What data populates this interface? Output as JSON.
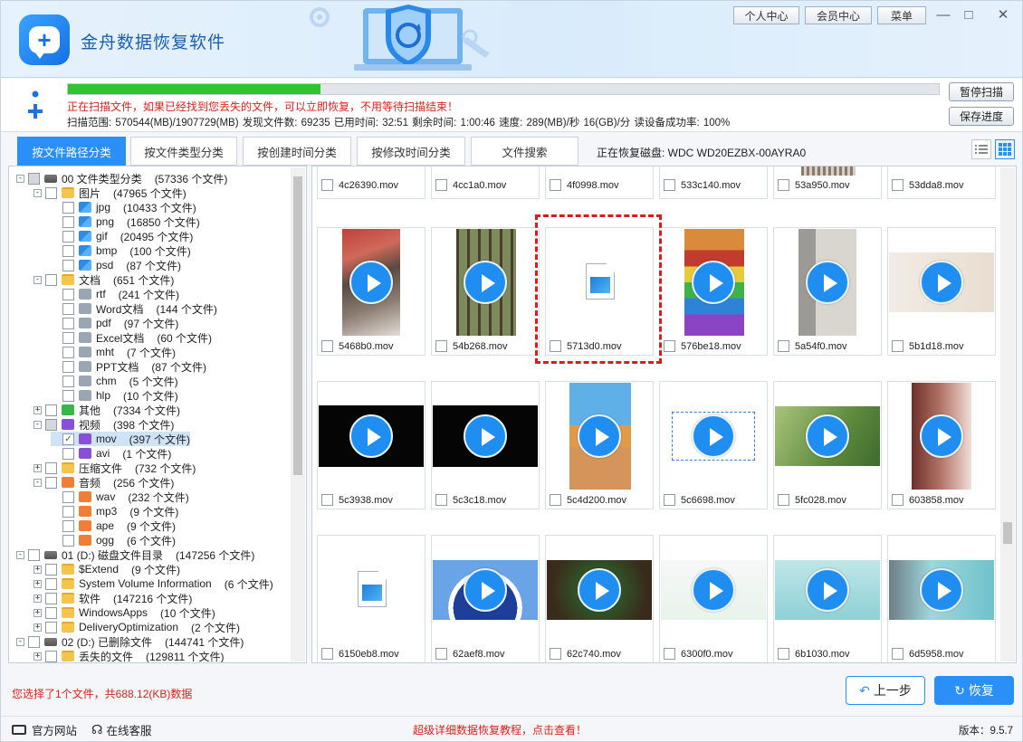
{
  "app": {
    "title": "金舟数据恢复软件",
    "version": "版本：9.5.7"
  },
  "header": {
    "personal": "个人中心",
    "member": "会员中心",
    "menu": "菜单"
  },
  "scan": {
    "progress": 0.29,
    "message": "正在扫描文件，如果已经找到您丢失的文件，可以立即恢复，不用等待扫描结束！",
    "stats": "扫描范围: 570544(MB)/1907729(MB)   发现文件数: 69235   已用时间: 32:51   剩余时间: 1:00:46   速度: 289(MB)/秒  16(GB)/分   读设备成功率: 100%",
    "pause": "暂停扫描",
    "save": "保存进度"
  },
  "tabs": [
    "按文件路径分类",
    "按文件类型分类",
    "按创建时间分类",
    "按修改时间分类",
    "文件搜索"
  ],
  "disk": "正在恢复磁盘: WDC WD20EZBX-00AYRA0",
  "tree": [
    {
      "d": 0,
      "exp": "-",
      "cb": "part",
      "ic": "drive",
      "label": "00 文件类型分类",
      "count": "(57336 个文件)"
    },
    {
      "d": 1,
      "exp": "-",
      "cb": "",
      "ic": "folder",
      "label": "图片",
      "count": "(47965 个文件)"
    },
    {
      "d": 2,
      "exp": "",
      "cb": "",
      "ic": "img",
      "label": "jpg",
      "count": "(10433 个文件)"
    },
    {
      "d": 2,
      "exp": "",
      "cb": "",
      "ic": "img",
      "label": "png",
      "count": "(16850 个文件)"
    },
    {
      "d": 2,
      "exp": "",
      "cb": "",
      "ic": "img",
      "label": "gif",
      "count": "(20495 个文件)"
    },
    {
      "d": 2,
      "exp": "",
      "cb": "",
      "ic": "img",
      "label": "bmp",
      "count": "(100 个文件)"
    },
    {
      "d": 2,
      "exp": "",
      "cb": "",
      "ic": "img",
      "label": "psd",
      "count": "(87 个文件)"
    },
    {
      "d": 1,
      "exp": "-",
      "cb": "",
      "ic": "folder",
      "label": "文档",
      "count": "(651 个文件)"
    },
    {
      "d": 2,
      "exp": "",
      "cb": "",
      "ic": "gfolder",
      "label": "rtf",
      "count": "(241 个文件)"
    },
    {
      "d": 2,
      "exp": "",
      "cb": "",
      "ic": "gfolder",
      "label": "Word文档",
      "count": "(144 个文件)"
    },
    {
      "d": 2,
      "exp": "",
      "cb": "",
      "ic": "gfolder",
      "label": "pdf",
      "count": "(97 个文件)"
    },
    {
      "d": 2,
      "exp": "",
      "cb": "",
      "ic": "gfolder",
      "label": "Excel文档",
      "count": "(60 个文件)"
    },
    {
      "d": 2,
      "exp": "",
      "cb": "",
      "ic": "gfolder",
      "label": "mht",
      "count": "(7 个文件)"
    },
    {
      "d": 2,
      "exp": "",
      "cb": "",
      "ic": "gfolder",
      "label": "PPT文档",
      "count": "(87 个文件)"
    },
    {
      "d": 2,
      "exp": "",
      "cb": "",
      "ic": "gfolder",
      "label": "chm",
      "count": "(5 个文件)"
    },
    {
      "d": 2,
      "exp": "",
      "cb": "",
      "ic": "gfolder",
      "label": "hlp",
      "count": "(10 个文件)"
    },
    {
      "d": 1,
      "exp": "+",
      "cb": "",
      "ic": "green",
      "label": "其他",
      "count": "(7334 个文件)"
    },
    {
      "d": 1,
      "exp": "-",
      "cb": "part",
      "ic": "purple",
      "label": "视频",
      "count": "(398 个文件)"
    },
    {
      "d": 2,
      "exp": "",
      "cb": "chk",
      "ic": "vid",
      "label": "mov",
      "count": "(397 个文件)",
      "sel": true
    },
    {
      "d": 2,
      "exp": "",
      "cb": "",
      "ic": "vid",
      "label": "avi",
      "count": "(1 个文件)"
    },
    {
      "d": 1,
      "exp": "+",
      "cb": "",
      "ic": "folder",
      "label": "压缩文件",
      "count": "(732 个文件)"
    },
    {
      "d": 1,
      "exp": "-",
      "cb": "",
      "ic": "orange",
      "label": "音频",
      "count": "(256 个文件)"
    },
    {
      "d": 2,
      "exp": "",
      "cb": "",
      "ic": "aud",
      "label": "wav",
      "count": "(232 个文件)"
    },
    {
      "d": 2,
      "exp": "",
      "cb": "",
      "ic": "aud",
      "label": "mp3",
      "count": "(9 个文件)"
    },
    {
      "d": 2,
      "exp": "",
      "cb": "",
      "ic": "aud",
      "label": "ape",
      "count": "(9 个文件)"
    },
    {
      "d": 2,
      "exp": "",
      "cb": "",
      "ic": "aud",
      "label": "ogg",
      "count": "(6 个文件)"
    },
    {
      "d": 0,
      "exp": "-",
      "cb": "",
      "ic": "drive",
      "label": "01 (D:) 磁盘文件目录",
      "count": "(147256 个文件)"
    },
    {
      "d": 1,
      "exp": "+",
      "cb": "",
      "ic": "folder",
      "label": "$Extend",
      "count": "(9 个文件)"
    },
    {
      "d": 1,
      "exp": "+",
      "cb": "",
      "ic": "folder",
      "label": "System Volume Information",
      "count": "(6 个文件)"
    },
    {
      "d": 1,
      "exp": "+",
      "cb": "",
      "ic": "folder",
      "label": "软件",
      "count": "(147216 个文件)"
    },
    {
      "d": 1,
      "exp": "+",
      "cb": "",
      "ic": "folder",
      "label": "WindowsApps",
      "count": "(10 个文件)"
    },
    {
      "d": 1,
      "exp": "+",
      "cb": "",
      "ic": "folder",
      "label": "DeliveryOptimization",
      "count": "(2 个文件)"
    },
    {
      "d": 0,
      "exp": "-",
      "cb": "",
      "ic": "drive",
      "label": "02 (D:) 已删除文件",
      "count": "(144741 个文件)"
    },
    {
      "d": 1,
      "exp": "+",
      "cb": "",
      "ic": "folder",
      "label": "丢失的文件",
      "count": "(129811 个文件)"
    }
  ],
  "top_row": [
    "4c26390.mov",
    "4cc1a0.mov",
    "4f0998.mov",
    "533c140.mov",
    "53a950.mov",
    "53dda8.mov"
  ],
  "files": [
    {
      "name": "5468b0.mov",
      "thumb": "cat",
      "play": true
    },
    {
      "name": "54b268.mov",
      "thumb": "forest",
      "play": true
    },
    {
      "name": "5713d0.mov",
      "thumb": "file",
      "play": false,
      "highlight": true
    },
    {
      "name": "576be18.mov",
      "thumb": "game",
      "play": true
    },
    {
      "name": "5a54f0.mov",
      "thumb": "room",
      "play": true
    },
    {
      "name": "5b1d18.mov",
      "thumb": "wall",
      "play": true
    },
    {
      "name": "5c3938.mov",
      "thumb": "black",
      "play": true
    },
    {
      "name": "5c3c18.mov",
      "thumb": "black",
      "play": true
    },
    {
      "name": "5c4d200.mov",
      "thumb": "desert",
      "play": true
    },
    {
      "name": "5c6698.mov",
      "thumb": "white",
      "play": true
    },
    {
      "name": "5fc028.mov",
      "thumb": "bird",
      "play": true
    },
    {
      "name": "603858.mov",
      "thumb": "street",
      "play": true
    },
    {
      "name": "6150eb8.mov",
      "thumb": "file",
      "play": false
    },
    {
      "name": "62aef8.mov",
      "thumb": "sign",
      "play": true
    },
    {
      "name": "62c740.mov",
      "thumb": "tree",
      "play": true
    },
    {
      "name": "6300f0.mov",
      "thumb": "web",
      "play": true
    },
    {
      "name": "6b1030.mov",
      "thumb": "teal",
      "play": true
    },
    {
      "name": "6d5958.mov",
      "thumb": "teal2",
      "play": true
    }
  ],
  "status": "您选择了1个文件，共688.12(KB)数据",
  "buttons": {
    "prev": "上一步",
    "recover": "恢复"
  },
  "footer": {
    "site": "官方网站",
    "service": "在线客服",
    "promo": "超级详细数据恢复教程，点击查看！"
  }
}
